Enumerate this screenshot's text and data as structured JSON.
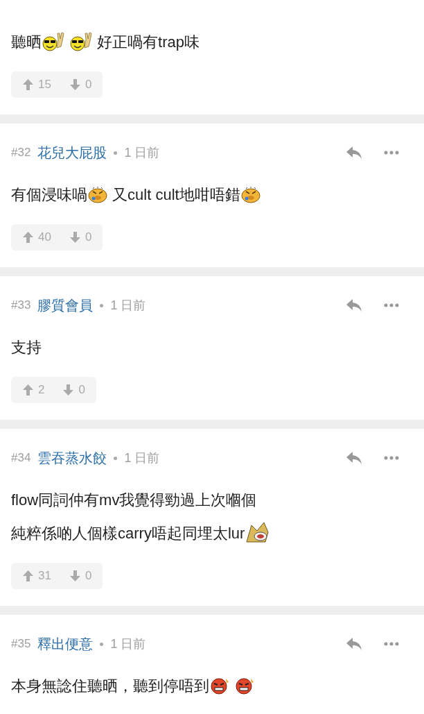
{
  "posts": [
    {
      "body": [
        [
          {
            "kind": "text",
            "text": "聽晒"
          },
          {
            "kind": "shades"
          },
          {
            "kind": "shades"
          },
          {
            "kind": "text",
            "text": " 好正喎有trap味"
          }
        ]
      ],
      "upvotes": "15",
      "downvotes": "0"
    },
    {
      "number": "#32",
      "author": "花兒大屁股",
      "time": "1 日前",
      "body": [
        [
          {
            "kind": "text",
            "text": "有個浸味喎"
          },
          {
            "kind": "crying"
          },
          {
            "kind": "text",
            "text": " 又cult cult地咁唔錯"
          },
          {
            "kind": "crying"
          }
        ]
      ],
      "upvotes": "40",
      "downvotes": "0"
    },
    {
      "number": "#33",
      "author": "膠質會員",
      "time": "1 日前",
      "body": [
        [
          {
            "kind": "text",
            "text": "支持"
          }
        ]
      ],
      "upvotes": "2",
      "downvotes": "0"
    },
    {
      "number": "#34",
      "author": "雲吞蒸水餃",
      "time": "1 日前",
      "body": [
        [
          {
            "kind": "text",
            "text": "flow同詞仲有mv我覺得勁過上次嗰個"
          }
        ],
        [
          {
            "kind": "text",
            "text": "純粹係啲人個樣carry唔起同埋太lur"
          },
          {
            "kind": "dog"
          }
        ]
      ],
      "upvotes": "31",
      "downvotes": "0"
    },
    {
      "number": "#35",
      "author": "釋出便意",
      "time": "1 日前",
      "body": [
        [
          {
            "kind": "text",
            "text": "本身無諗住聽晒，聽到停唔到"
          },
          {
            "kind": "angry"
          },
          {
            "kind": "angry"
          }
        ]
      ]
    }
  ]
}
